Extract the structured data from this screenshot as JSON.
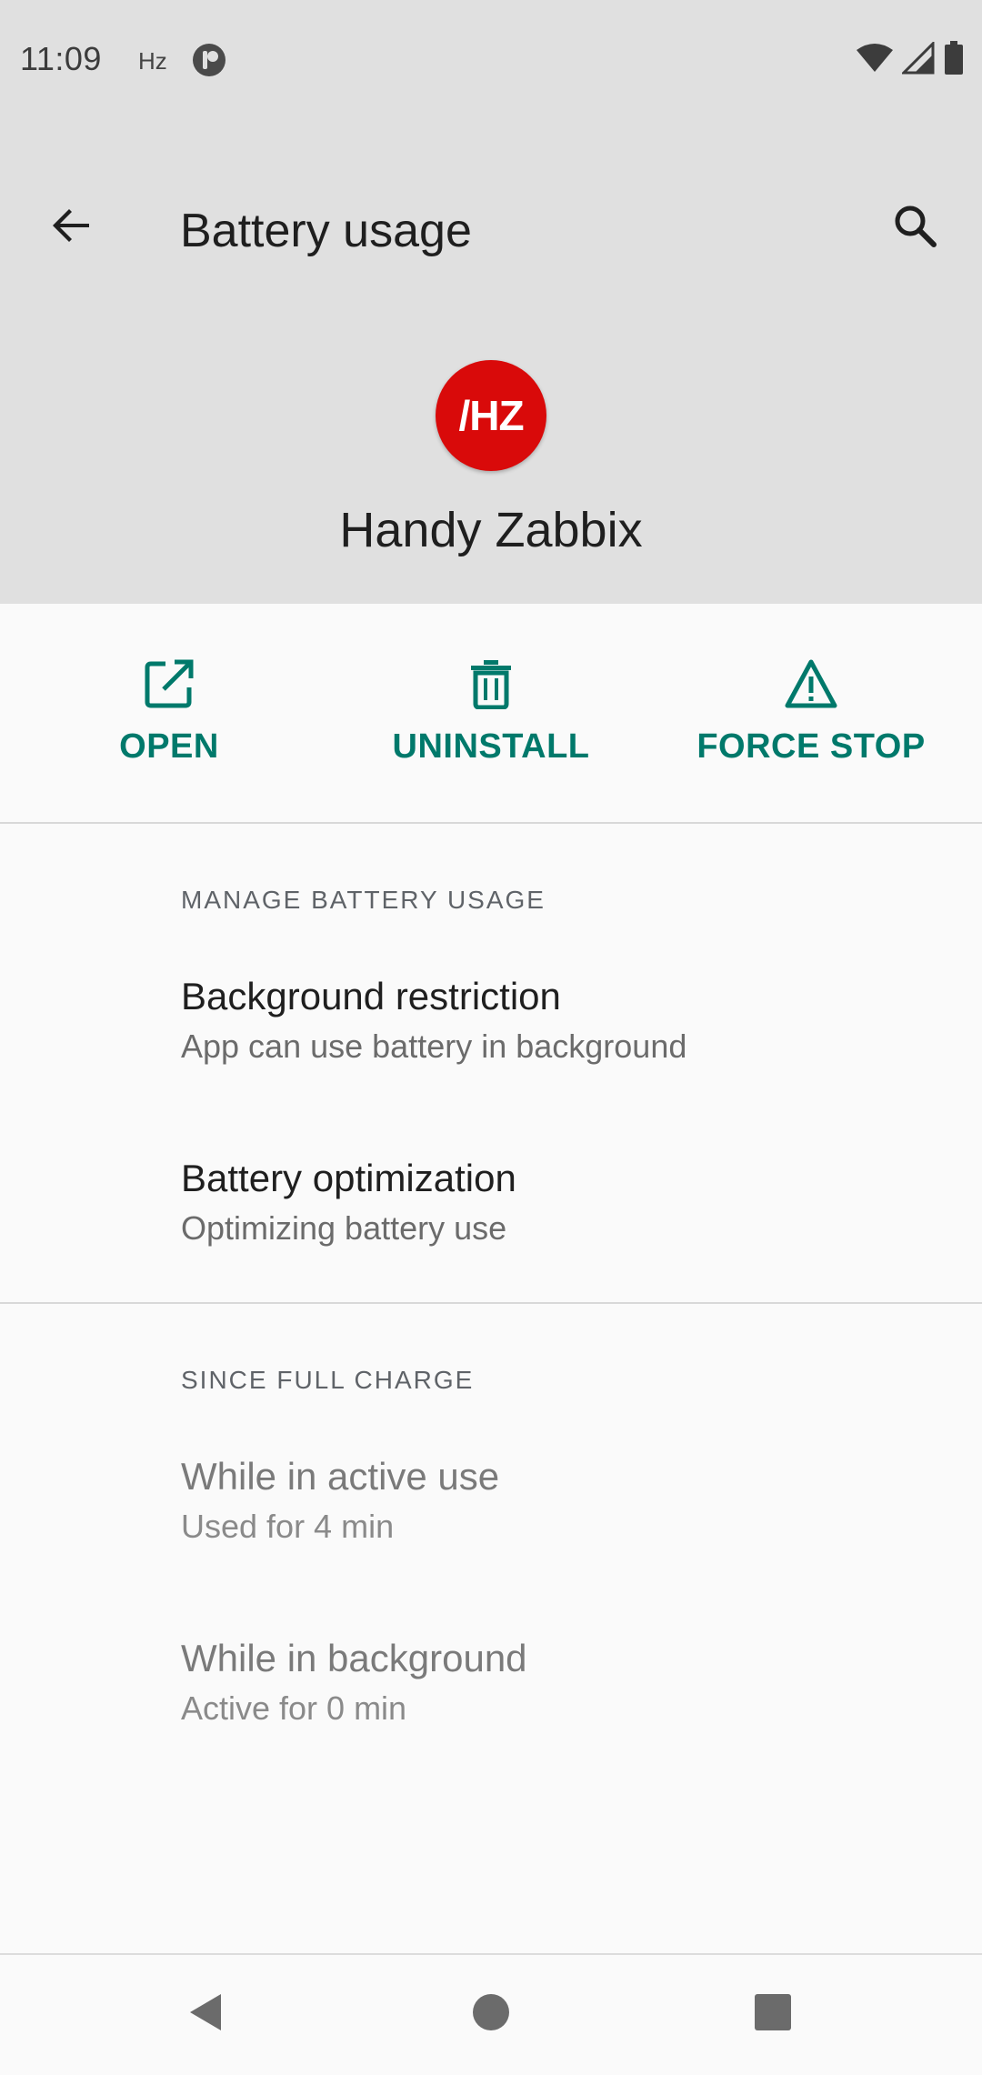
{
  "status_bar": {
    "time": "11:09",
    "hz_label": "Hz",
    "icons": [
      "notification-icon",
      "wifi-icon",
      "signal-icon",
      "battery-icon"
    ]
  },
  "app_bar": {
    "title": "Battery usage",
    "back_icon": "back-arrow-icon",
    "search_icon": "search-icon"
  },
  "app_header": {
    "icon_text": "/HZ",
    "icon_color": "#d90a0a",
    "app_name": "Handy Zabbix"
  },
  "actions": [
    {
      "label": "OPEN",
      "icon": "open-external-icon"
    },
    {
      "label": "UNINSTALL",
      "icon": "trash-icon"
    },
    {
      "label": "FORCE STOP",
      "icon": "warning-icon"
    }
  ],
  "accent_color": "#00796b",
  "sections": {
    "manage": {
      "header": "MANAGE BATTERY USAGE",
      "items": [
        {
          "title": "Background restriction",
          "summary": "App can use battery in background"
        },
        {
          "title": "Battery optimization",
          "summary": "Optimizing battery use"
        }
      ]
    },
    "since_full_charge": {
      "header": "SINCE FULL CHARGE",
      "items": [
        {
          "title": "While in active use",
          "summary": "Used for 4 min"
        },
        {
          "title": "While in background",
          "summary": "Active for 0 min"
        }
      ]
    }
  },
  "nav_bar": {
    "icons": [
      "back-triangle-icon",
      "home-circle-icon",
      "recents-square-icon"
    ]
  }
}
